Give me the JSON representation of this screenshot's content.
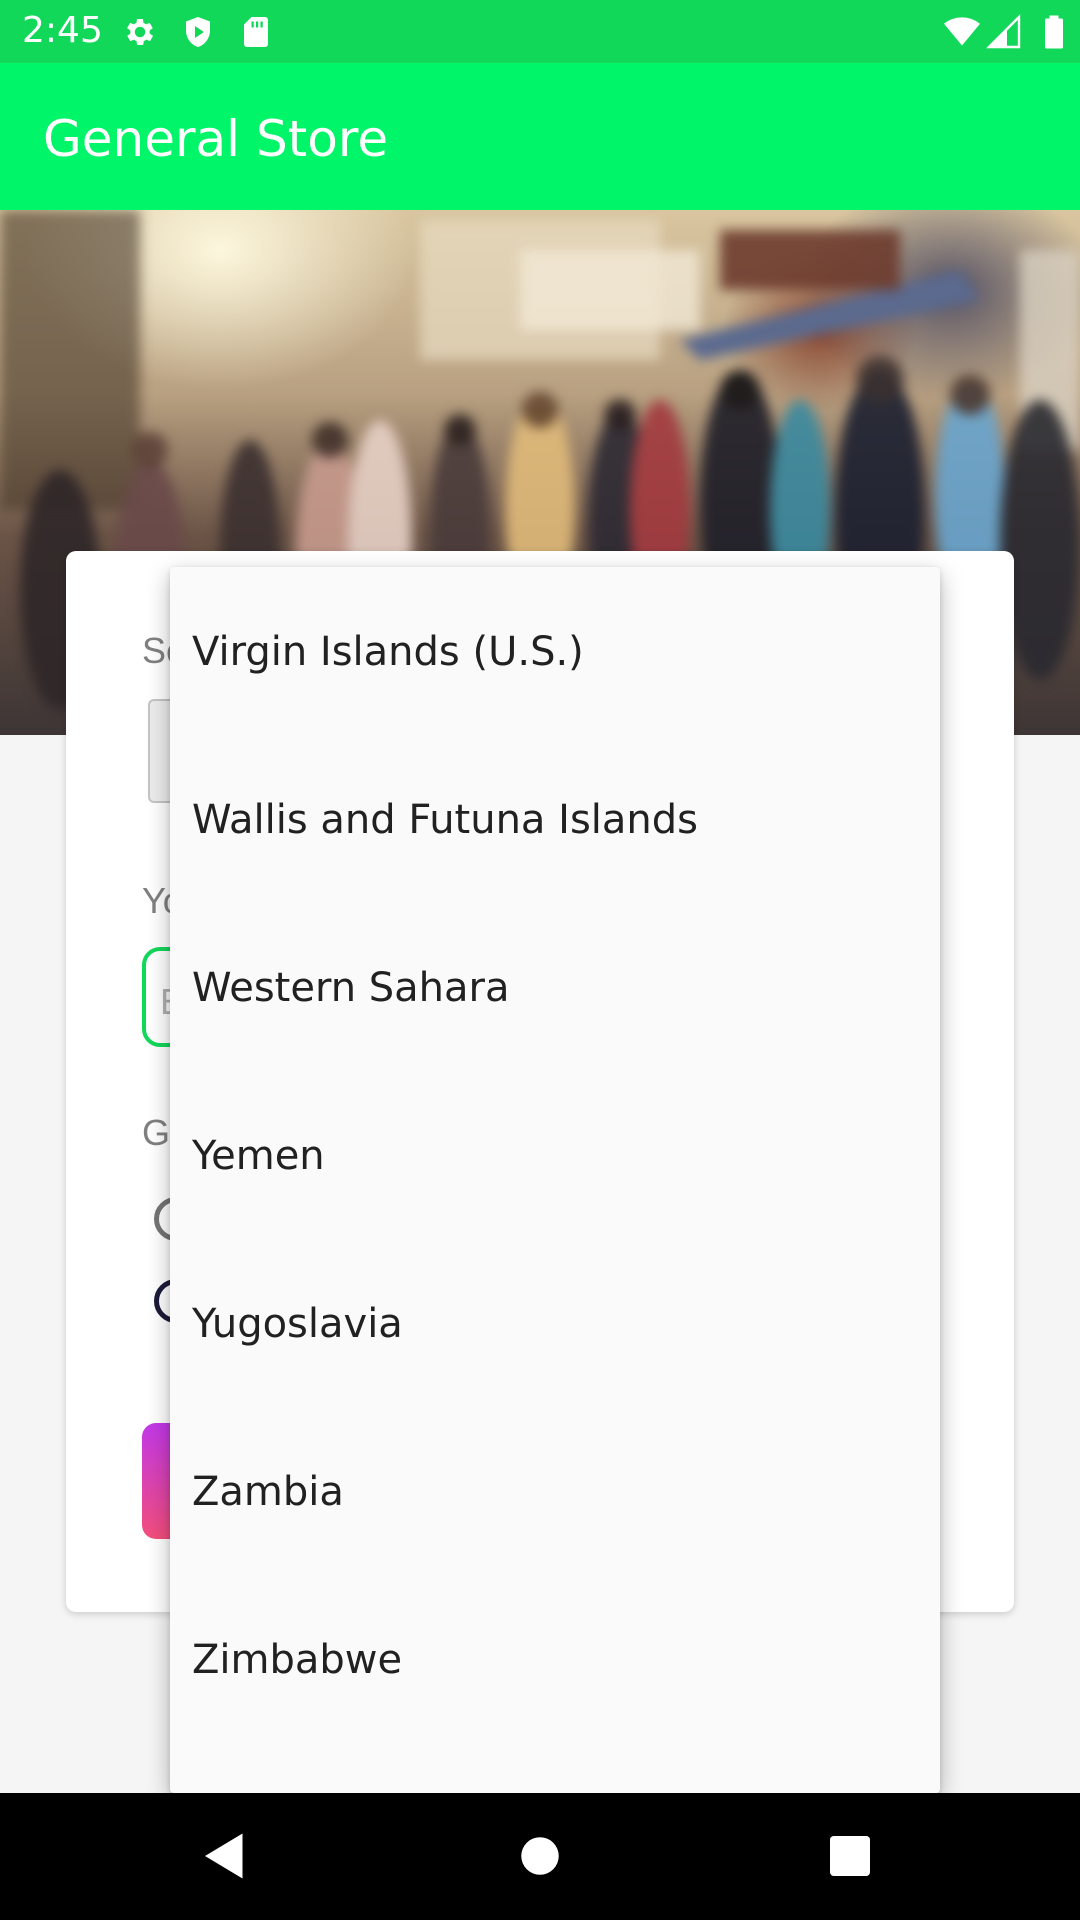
{
  "status_bar": {
    "time": "2:45",
    "icons_left": [
      "gear-icon",
      "play-protect-icon",
      "sd-card-icon"
    ],
    "icons_right": [
      "wifi-icon",
      "signal-icon",
      "battery-icon"
    ]
  },
  "app_bar": {
    "title": "General Store",
    "color": "#00f569"
  },
  "form": {
    "country_label_fragment": "Se",
    "name_label_fragment": "Yo",
    "name_placeholder_fragment": "E",
    "gender_label_fragment": "Ge"
  },
  "dropdown": {
    "items": [
      {
        "label": "Virgin Islands (U.S.)"
      },
      {
        "label": "Wallis and Futuna Islands"
      },
      {
        "label": "Western Sahara"
      },
      {
        "label": "Yemen"
      },
      {
        "label": "Yugoslavia"
      },
      {
        "label": "Zambia"
      },
      {
        "label": "Zimbabwe"
      }
    ]
  },
  "nav_bar": {
    "buttons": [
      "back-icon",
      "home-icon",
      "recents-icon"
    ]
  },
  "colors": {
    "status_bar": "#12d85a",
    "accent_green": "#12d85a",
    "button_gradient_start": "#c238e8",
    "button_gradient_end": "#f34e7b"
  }
}
